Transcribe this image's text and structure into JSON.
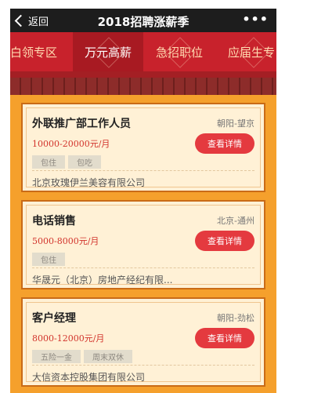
{
  "navbar": {
    "back_label": "返回",
    "title": "2018招聘涨薪季",
    "more_label": "•••"
  },
  "tabs": [
    {
      "label": "白领专区",
      "active": false
    },
    {
      "label": "万元高薪",
      "active": true
    },
    {
      "label": "急招职位",
      "active": false
    },
    {
      "label": "应届生专",
      "active": false
    }
  ],
  "jobs": [
    {
      "title": "外联推广部工作人员",
      "location": "朝阳-望京",
      "salary": "10000-20000元/月",
      "button": "查看详情",
      "tags": [
        "包住",
        "包吃"
      ],
      "company": "北京玫瑰伊兰美容有限公司"
    },
    {
      "title": "电话销售",
      "location": "北京-通州",
      "salary": "5000-8000元/月",
      "button": "查看详情",
      "tags": [
        "包住"
      ],
      "company": "华晟元（北京）房地产经纪有限..."
    },
    {
      "title": "客户经理",
      "location": "朝阳-劲松",
      "salary": "8000-12000元/月",
      "button": "查看详情",
      "tags": [
        "五险一金",
        "周末双休"
      ],
      "company": "大信资本控股集团有限公司"
    }
  ],
  "colors": {
    "nav_bg": "#1d1d1d",
    "tab_bg": "#c8222c",
    "page_bg": "#f5a02c",
    "card_bg": "#fff1d6",
    "button": "#e43a3f",
    "salary": "#d2332c"
  }
}
